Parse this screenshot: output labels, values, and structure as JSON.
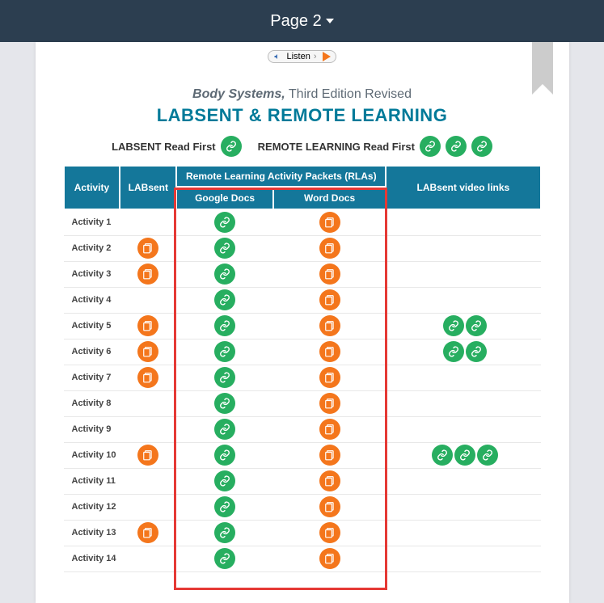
{
  "topbar": {
    "page_label": "Page 2"
  },
  "listen_label": "Listen",
  "titleblock": {
    "prefix_italic": "Body Systems,",
    "prefix_rest": " Third Edition Revised",
    "main": "LABSENT & REMOTE LEARNING"
  },
  "readfirst": {
    "labsent_label": "LABSENT Read First",
    "remote_label": "REMOTE LEARNING Read First"
  },
  "table": {
    "headers": {
      "activity": "Activity",
      "labsent": "LABsent",
      "rla_group": "Remote Learning Activity Packets (RLAs)",
      "google_docs": "Google Docs",
      "word_docs": "Word Docs",
      "video": "LABsent video links"
    },
    "rows": [
      {
        "label": "Activity 1",
        "labsent": false,
        "gdoc": true,
        "wdoc": true,
        "videos": 0
      },
      {
        "label": "Activity 2",
        "labsent": true,
        "gdoc": true,
        "wdoc": true,
        "videos": 0
      },
      {
        "label": "Activity 3",
        "labsent": true,
        "gdoc": true,
        "wdoc": true,
        "videos": 0
      },
      {
        "label": "Activity 4",
        "labsent": false,
        "gdoc": true,
        "wdoc": true,
        "videos": 0
      },
      {
        "label": "Activity 5",
        "labsent": true,
        "gdoc": true,
        "wdoc": true,
        "videos": 2
      },
      {
        "label": "Activity 6",
        "labsent": true,
        "gdoc": true,
        "wdoc": true,
        "videos": 2
      },
      {
        "label": "Activity 7",
        "labsent": true,
        "gdoc": true,
        "wdoc": true,
        "videos": 0
      },
      {
        "label": "Activity 8",
        "labsent": false,
        "gdoc": true,
        "wdoc": true,
        "videos": 0
      },
      {
        "label": "Activity 9",
        "labsent": false,
        "gdoc": true,
        "wdoc": true,
        "videos": 0
      },
      {
        "label": "Activity 10",
        "labsent": true,
        "gdoc": true,
        "wdoc": true,
        "videos": 3
      },
      {
        "label": "Activity 11",
        "labsent": false,
        "gdoc": true,
        "wdoc": true,
        "videos": 0
      },
      {
        "label": "Activity 12",
        "labsent": false,
        "gdoc": true,
        "wdoc": true,
        "videos": 0
      },
      {
        "label": "Activity 13",
        "labsent": true,
        "gdoc": true,
        "wdoc": true,
        "videos": 0
      },
      {
        "label": "Activity 14",
        "labsent": false,
        "gdoc": true,
        "wdoc": true,
        "videos": 0
      }
    ]
  }
}
